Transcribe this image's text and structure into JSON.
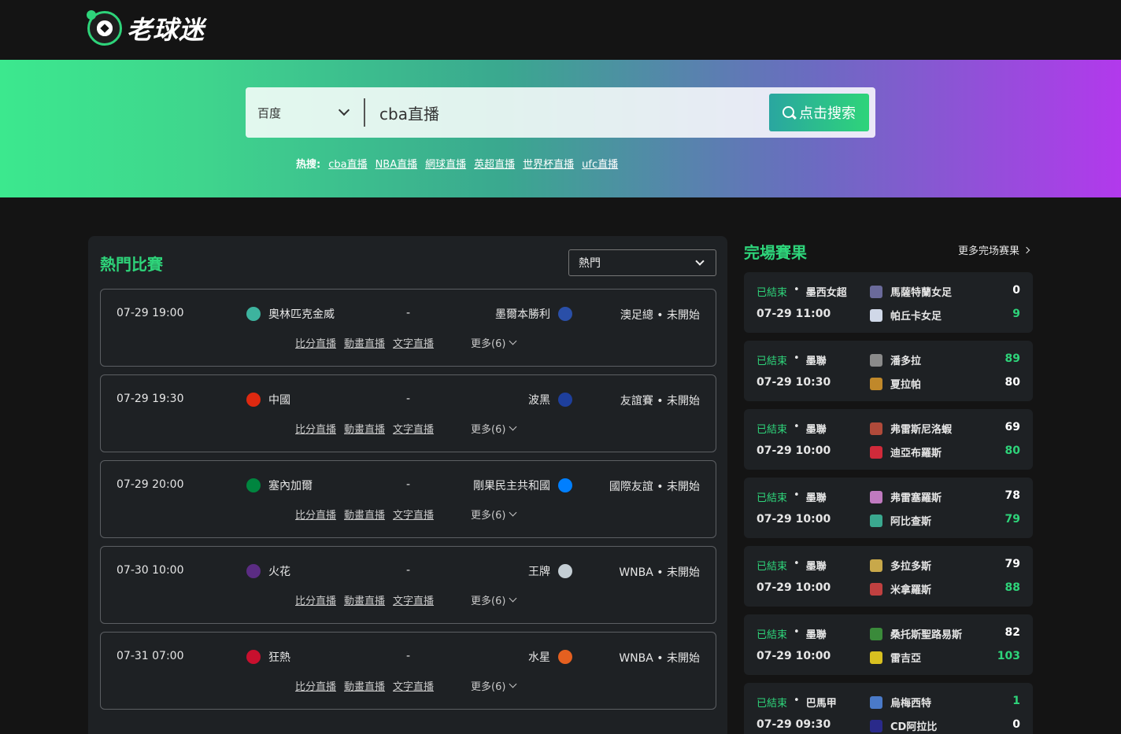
{
  "brand": {
    "name": "老球迷"
  },
  "search": {
    "engine": "百度",
    "query": "cba直播",
    "button_label": "点击搜索",
    "hot_label": "热搜:",
    "hot_links": [
      "cba直播",
      "NBA直播",
      "網球直播",
      "英超直播",
      "世界杯直播",
      "ufc直播"
    ]
  },
  "hot_matches": {
    "title": "熱門比賽",
    "filter_value": "熱門",
    "link_labels": [
      "比分直播",
      "動畫直播",
      "文字直播"
    ],
    "items": [
      {
        "time": "07-29 19:00",
        "home": "奧林匹克金威",
        "dash": "-",
        "away": "墨爾本勝利",
        "league": "澳足總 • 未開始",
        "more": "更多(6)",
        "home_icon": "#3db39e",
        "away_icon": "#2a4fa8"
      },
      {
        "time": "07-29 19:30",
        "home": "中國",
        "dash": "-",
        "away": "波黑",
        "league": "友誼賽 • 未開始",
        "more": "更多(6)",
        "home_icon": "#de2910",
        "away_icon": "#1e3f9c"
      },
      {
        "time": "07-29 20:00",
        "home": "塞內加爾",
        "dash": "-",
        "away": "剛果民主共和國",
        "league": "國際友誼 • 未開始",
        "more": "更多(6)",
        "home_icon": "#00853f",
        "away_icon": "#007fff"
      },
      {
        "time": "07-30 10:00",
        "home": "火花",
        "dash": "-",
        "away": "王牌",
        "league": "WNBA • 未開始",
        "more": "更多(6)",
        "home_icon": "#5b2c83",
        "away_icon": "#c4ced4"
      },
      {
        "time": "07-31 07:00",
        "home": "狂熱",
        "dash": "-",
        "away": "水星",
        "league": "WNBA • 未開始",
        "more": "更多(6)",
        "home_icon": "#c8102e",
        "away_icon": "#e56020"
      }
    ]
  },
  "results": {
    "title": "完場賽果",
    "more_label": "更多完场赛果",
    "items": [
      {
        "status": "已結束",
        "league": "墨西女超",
        "time": "07-29 11:00",
        "team1": "馬薩特蘭女足",
        "score1": "0",
        "team2": "帕丘卡女足",
        "score2": "9",
        "s1_color": "#ffffff",
        "s2_color": "#2ed47a",
        "i1": "#6a6a9a",
        "i2": "#d0d8e8"
      },
      {
        "status": "已結束",
        "league": "墨聯",
        "time": "07-29 10:30",
        "team1": "潘多拉",
        "score1": "89",
        "team2": "夏拉帕",
        "score2": "80",
        "s1_color": "#2ed47a",
        "s2_color": "#ffffff",
        "i1": "#8a8a8a",
        "i2": "#c0882a"
      },
      {
        "status": "已結束",
        "league": "墨聯",
        "time": "07-29 10:00",
        "team1": "弗雷斯尼洛蝦",
        "score1": "69",
        "team2": "迪亞布羅斯",
        "score2": "80",
        "s1_color": "#ffffff",
        "s2_color": "#2ed47a",
        "i1": "#b04a3a",
        "i2": "#d02a3a"
      },
      {
        "status": "已結束",
        "league": "墨聯",
        "time": "07-29 10:00",
        "team1": "弗雷塞羅斯",
        "score1": "78",
        "team2": "阿比查斯",
        "score2": "79",
        "s1_color": "#ffffff",
        "s2_color": "#2ed47a",
        "i1": "#c07ac0",
        "i2": "#3aa88f"
      },
      {
        "status": "已結束",
        "league": "墨聯",
        "time": "07-29 10:00",
        "team1": "多拉多斯",
        "score1": "79",
        "team2": "米拿羅斯",
        "score2": "88",
        "s1_color": "#ffffff",
        "s2_color": "#2ed47a",
        "i1": "#c8a84a",
        "i2": "#c04040"
      },
      {
        "status": "已結束",
        "league": "墨聯",
        "time": "07-29 10:00",
        "team1": "桑托斯聖路易斯",
        "score1": "82",
        "team2": "雷吉亞",
        "score2": "103",
        "s1_color": "#ffffff",
        "s2_color": "#2ed47a",
        "i1": "#3a8a3a",
        "i2": "#d8c020"
      },
      {
        "status": "已結束",
        "league": "巴馬甲",
        "time": "07-29 09:30",
        "team1": "烏梅西特",
        "score1": "1",
        "team2": "CD阿拉比",
        "score2": "0",
        "s1_color": "#2ed47a",
        "s2_color": "#ffffff",
        "i1": "#4a7ac8",
        "i2": "#2a2a8a"
      }
    ]
  }
}
